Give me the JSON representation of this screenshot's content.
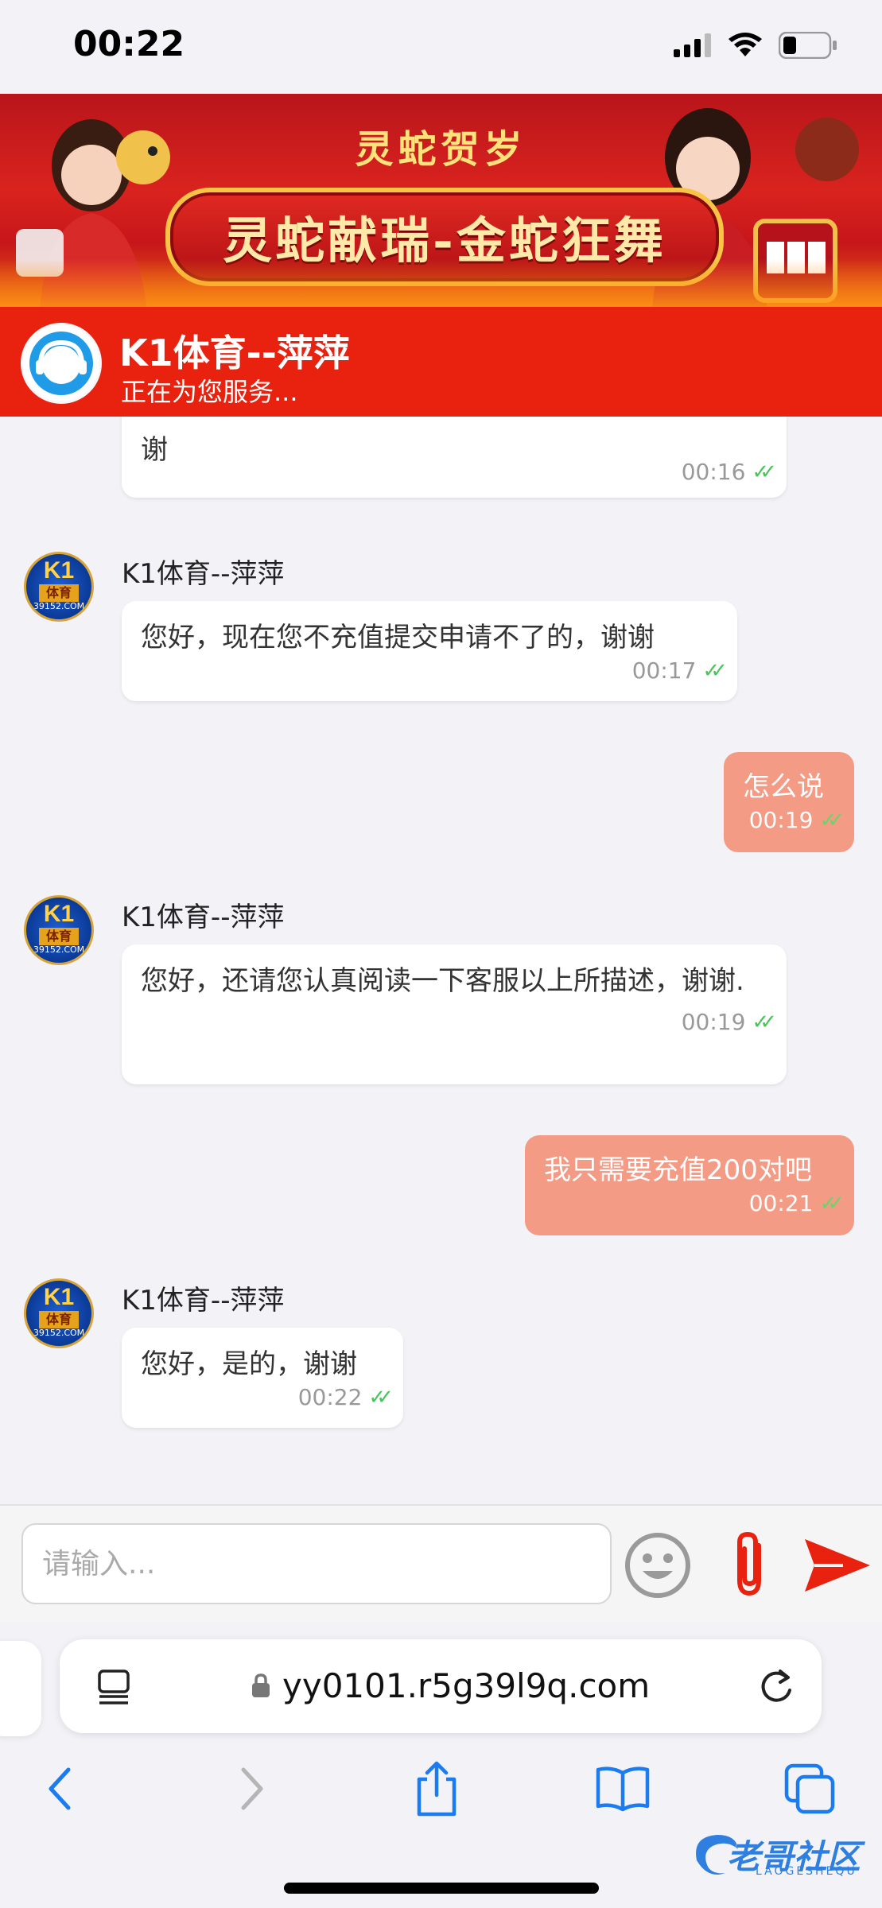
{
  "status_bar": {
    "time": "00:22"
  },
  "banner": {
    "small_title": "灵蛇贺岁",
    "main_title": "灵蛇献瑞-金蛇狂舞"
  },
  "header": {
    "name": "K1体育--萍萍",
    "status": "正在为您服务..."
  },
  "agent": {
    "name": "K1体育--萍萍",
    "avatar_text": "K1",
    "avatar_sub": "体育",
    "avatar_url": "39152.COM"
  },
  "messages": [
    {
      "from": "agent",
      "text": "谢",
      "time": "00:16"
    },
    {
      "from": "agent",
      "text": "您好，现在您不充值提交申请不了的，谢谢",
      "time": "00:17"
    },
    {
      "from": "user",
      "text": "怎么说",
      "time": "00:19"
    },
    {
      "from": "agent",
      "text": "您好，还请您认真阅读一下客服以上所描述，谢谢.",
      "time": "00:19"
    },
    {
      "from": "user",
      "text": "我只需要充值200对吧",
      "time": "00:21"
    },
    {
      "from": "agent",
      "text": "您好，是的，谢谢",
      "time": "00:22"
    }
  ],
  "composer": {
    "placeholder": "请输入..."
  },
  "browser": {
    "domain": "yy0101.r5g39l9q.com"
  },
  "watermark": {
    "text": "老哥社区",
    "sub": "LAOGESHEQU"
  },
  "colors": {
    "header": "#e8220f",
    "user_bubble": "#f49b86",
    "send": "#e8220f",
    "link": "#1a7cf0"
  },
  "icons": [
    "signal-icon",
    "wifi-icon",
    "battery-icon",
    "headset-icon",
    "check-icon",
    "emoji-icon",
    "paperclip-icon",
    "send-icon",
    "tabs-icon",
    "lock-icon",
    "reload-icon",
    "back-icon",
    "forward-icon",
    "share-icon",
    "bookmarks-icon",
    "tab-overview-icon"
  ]
}
